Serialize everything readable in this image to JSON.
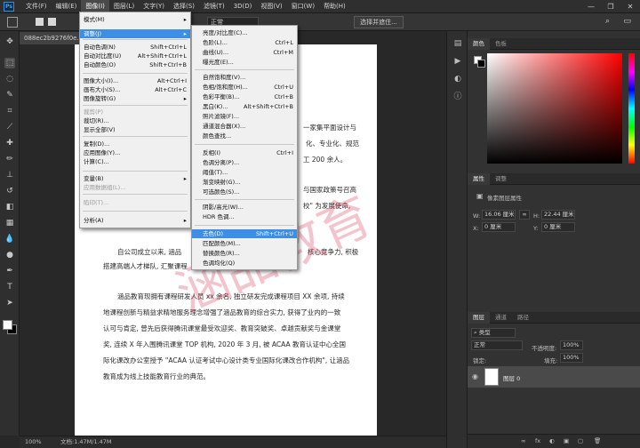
{
  "menubar": {
    "logo": "Ps",
    "items": [
      "文件(F)",
      "编辑(E)",
      "图像(I)",
      "图层(L)",
      "文字(Y)",
      "选择(S)",
      "滤镜(T)",
      "3D(D)",
      "视图(V)",
      "窗口(W)",
      "帮助(H)"
    ],
    "active_index": 2,
    "window_buttons": [
      "—",
      "❐",
      "✕"
    ]
  },
  "options": {
    "field_value": "正常",
    "select_subject": "选择并遮住...",
    "search_icon": "⌕",
    "layout_icon": "▭"
  },
  "document": {
    "tab_title": "088ec2b9276f0e...",
    "zoom": "100%",
    "doc_info": "文档:1.47M/1.47M",
    "paragraphs": [
      "一家集平面设计与",
      "化、专业化、规范",
      "工 200 余人。",
      "与国家政策号召高",
      "校\" 为发展使命,",
      "自公司成立以来, 涵品",
      "核心竞争力, 积极",
      "搭建高端人才梯队, 汇聚课程",
      "涵品教育现拥有课程研发人员 xx 余名, 独立研发完成课程项目 XX 余项, 持续",
      "地课程创新与精益求精地服务理念增强了涵品教育的综合实力, 获得了业内的一致",
      "认可与肯定, 曾先后获得腾讯课堂最受欢迎奖、教育突破奖、卓越贡献奖与金课堂",
      "奖, 连续 X 年入围腾讯课堂 TOP 机构, 2020 年 3 月, 被 ACAA 教育认证中心全国",
      "际化课改办公室授予 \"ACAA 认证考试中心设计类专业国际化课改合作机构\", 让涵品",
      "教育成为线上技能教育行业的典范。"
    ],
    "watermark": "涵品教育"
  },
  "image_menu": [
    {
      "label": "模式(M)",
      "shortcut": "",
      "arrow": true,
      "state": "normal"
    },
    {
      "label": "调整(J)",
      "shortcut": "",
      "arrow": true,
      "state": "hl"
    },
    {
      "label": "自动色调(N)",
      "shortcut": "Shift+Ctrl+L",
      "arrow": false,
      "state": "normal"
    },
    {
      "label": "自动对比度(U)",
      "shortcut": "Alt+Shift+Ctrl+L",
      "arrow": false,
      "state": "normal"
    },
    {
      "label": "自动颜色(O)",
      "shortcut": "Shift+Ctrl+B",
      "arrow": false,
      "state": "normal"
    },
    {
      "label": "图像大小(I)...",
      "shortcut": "Alt+Ctrl+I",
      "arrow": false,
      "state": "normal"
    },
    {
      "label": "画布大小(S)...",
      "shortcut": "Alt+Ctrl+C",
      "arrow": false,
      "state": "normal"
    },
    {
      "label": "图像旋转(G)",
      "shortcut": "",
      "arrow": true,
      "state": "normal"
    },
    {
      "label": "裁剪(P)",
      "shortcut": "",
      "arrow": false,
      "state": "dis"
    },
    {
      "label": "裁切(R)...",
      "shortcut": "",
      "arrow": false,
      "state": "normal"
    },
    {
      "label": "显示全部(V)",
      "shortcut": "",
      "arrow": false,
      "state": "normal"
    },
    {
      "label": "复制(D)...",
      "shortcut": "",
      "arrow": false,
      "state": "normal"
    },
    {
      "label": "应用图像(Y)...",
      "shortcut": "",
      "arrow": false,
      "state": "normal"
    },
    {
      "label": "计算(C)...",
      "shortcut": "",
      "arrow": false,
      "state": "normal"
    },
    {
      "label": "变量(B)",
      "shortcut": "",
      "arrow": true,
      "state": "normal"
    },
    {
      "label": "应用数据组(L)...",
      "shortcut": "",
      "arrow": false,
      "state": "dis"
    },
    {
      "label": "陷印(T)...",
      "shortcut": "",
      "arrow": false,
      "state": "dis"
    },
    {
      "label": "分析(A)",
      "shortcut": "",
      "arrow": true,
      "state": "normal"
    }
  ],
  "adjust_menu": [
    {
      "label": "亮度/对比度(C)...",
      "shortcut": "",
      "state": "normal"
    },
    {
      "label": "色阶(L)...",
      "shortcut": "Ctrl+L",
      "state": "normal"
    },
    {
      "label": "曲线(U)...",
      "shortcut": "Ctrl+M",
      "state": "normal"
    },
    {
      "label": "曝光度(E)...",
      "shortcut": "",
      "state": "normal"
    },
    {
      "label": "自然饱和度(V)...",
      "shortcut": "",
      "state": "normal"
    },
    {
      "label": "色相/饱和度(H)...",
      "shortcut": "Ctrl+U",
      "state": "normal"
    },
    {
      "label": "色彩平衡(B)...",
      "shortcut": "Ctrl+B",
      "state": "normal"
    },
    {
      "label": "黑白(K)...",
      "shortcut": "Alt+Shift+Ctrl+B",
      "state": "normal"
    },
    {
      "label": "照片滤镜(F)...",
      "shortcut": "",
      "state": "normal"
    },
    {
      "label": "通道混合器(X)...",
      "shortcut": "",
      "state": "normal"
    },
    {
      "label": "颜色查找...",
      "shortcut": "",
      "state": "normal"
    },
    {
      "label": "反相(I)",
      "shortcut": "Ctrl+I",
      "state": "normal"
    },
    {
      "label": "色调分离(P)...",
      "shortcut": "",
      "state": "normal"
    },
    {
      "label": "阈值(T)...",
      "shortcut": "",
      "state": "normal"
    },
    {
      "label": "渐变映射(G)...",
      "shortcut": "",
      "state": "normal"
    },
    {
      "label": "可选颜色(S)...",
      "shortcut": "",
      "state": "normal"
    },
    {
      "label": "阴影/高光(W)...",
      "shortcut": "",
      "state": "normal"
    },
    {
      "label": "HDR 色调...",
      "shortcut": "",
      "state": "normal"
    },
    {
      "label": "去色(D)",
      "shortcut": "Shift+Ctrl+U",
      "state": "hl"
    },
    {
      "label": "匹配颜色(M)...",
      "shortcut": "",
      "state": "normal"
    },
    {
      "label": "替换颜色(R)...",
      "shortcut": "",
      "state": "normal"
    },
    {
      "label": "色调均化(Q)",
      "shortcut": "",
      "state": "normal"
    }
  ],
  "panels": {
    "color_tabs": [
      "颜色",
      "色板"
    ],
    "props_tabs": [
      "属性",
      "调整"
    ],
    "props_title": "像素图层属性",
    "w_label": "W:",
    "w_value": "16.06 厘米",
    "h_label": "H:",
    "h_value": "22.44 厘米",
    "x_label": "X:",
    "x_value": "0 厘米",
    "y_label": "Y:",
    "y_value": "0 厘米",
    "link_icon": "∞",
    "layers_tabs": [
      "图层",
      "通道",
      "路径"
    ],
    "kind_label": "类型",
    "blend_mode": "正常",
    "opacity_label": "不透明度:",
    "opacity_value": "100%",
    "lock_label": "锁定:",
    "fill_label": "填充:",
    "fill_value": "100%",
    "layer_name": "图层 0",
    "footer_icons": [
      "∞",
      "fx",
      "◐",
      "▣",
      "▢",
      "🗑"
    ]
  },
  "colors": {
    "accent": "#3c8ee6",
    "fg": "#ffffff",
    "bg": "#000000"
  }
}
